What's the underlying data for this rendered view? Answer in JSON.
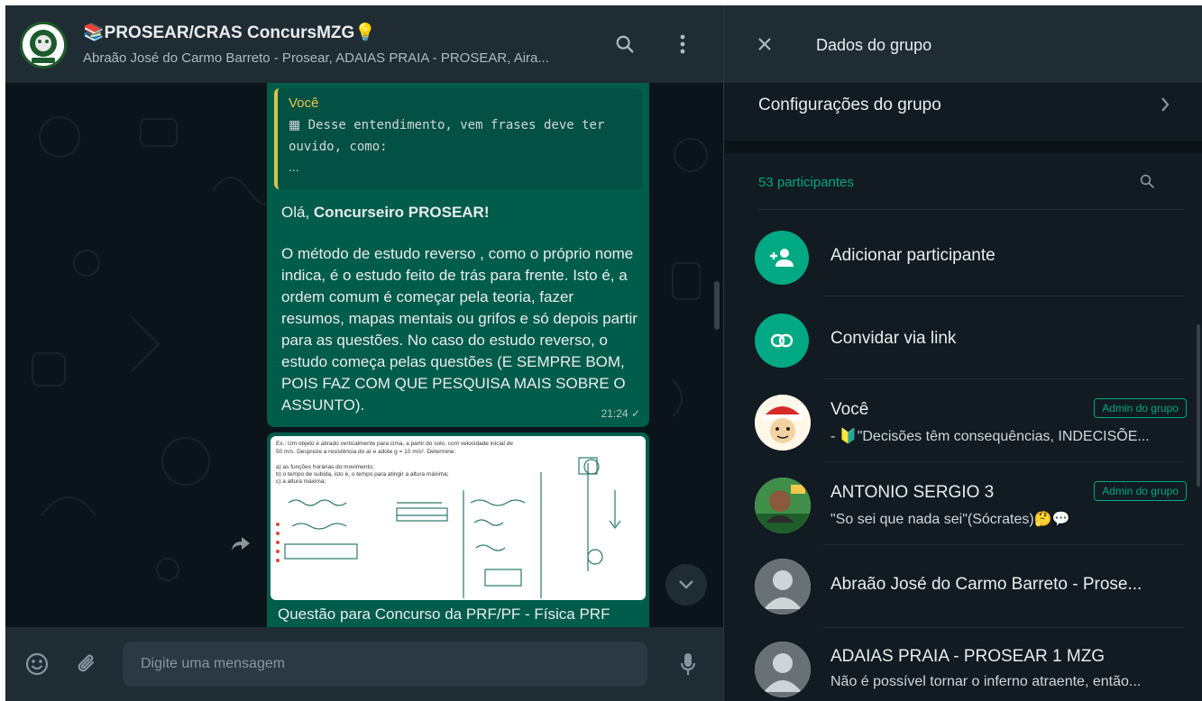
{
  "chat": {
    "group_title": "📚PROSEAR/CRAS ConcursMZG💡",
    "group_subtitle": "Abraão José do Carmo Barreto - Prosear, ADAIAS PRAIA - PROSEAR, Aira...",
    "search_icon": "search-icon",
    "menu_icon": "kebab-menu-icon",
    "quoted": {
      "author": "Você",
      "text": "Desse entendimento, vem frases deve ter ouvido, como:",
      "ellipsis": "..."
    },
    "message": {
      "greeting_prefix": "Olá, ",
      "greeting_bold": "Concurseiro PROSEAR!",
      "body": "O método de estudo reverso , como o próprio nome indica, é o estudo feito de trás para frente. Isto é, a ordem comum é começar pela teoria, fazer resumos, mapas mentais ou grifos e só depois partir para as questões. No caso do estudo reverso, o estudo começa pelas questões (E SEMPRE BOM, POIS FAZ COM QUE PESQUISA MAIS SOBRE O ASSUNTO).",
      "time": "21:24 ✓"
    },
    "image_message": {
      "problem_line1": "Ex.: Um objeto é atirado verticalmente para cima, a partir do solo, com velocidade inicial de",
      "problem_line2": "50 m/s. Despreze a resistência do ar e adote g = 10 m/s². Determine:",
      "item_a": "a)  as funções horárias do movimento;",
      "item_b": "b)  o tempo de subida, isto é, o tempo para atingir a altura máxima;",
      "item_c": "c)  a altura máxima;",
      "caption": "Questão para Concurso da PRF/PF - Física PRF"
    },
    "composer": {
      "placeholder": "Digite uma mensagem",
      "emoji_icon": "emoji-icon",
      "attach_icon": "paperclip-icon",
      "mic_icon": "microphone-icon"
    }
  },
  "drawer": {
    "title": "Dados do grupo",
    "settings_label": "Configurações do grupo",
    "participants_count": "53 participantes",
    "actions": [
      {
        "label": "Adicionar participante",
        "icon": "add-person-icon"
      },
      {
        "label": "Convidar via link",
        "icon": "link-icon"
      }
    ],
    "members": [
      {
        "name": "Você",
        "status": "- 🔰\"Decisões têm consequências, INDECISÕE...",
        "badge": "Admin do grupo"
      },
      {
        "name": "ANTONIO SERGIO 3",
        "status": "\"So sei que nada sei\"(Sócrates)🤔💬",
        "badge": "Admin do grupo"
      },
      {
        "name": "Abraão José do Carmo Barreto - Prose...",
        "status": "",
        "badge": ""
      },
      {
        "name": "ADAIAS PRAIA - PROSEAR 1 MZG",
        "status": "Não é possível tornar o inferno atraente, então...",
        "badge": ""
      }
    ]
  },
  "colors": {
    "accent": "#00a884",
    "outgoing_bubble": "#005c4b",
    "panel": "#202c33",
    "background": "#0b141a",
    "quote_bar": "#d9c44a"
  }
}
